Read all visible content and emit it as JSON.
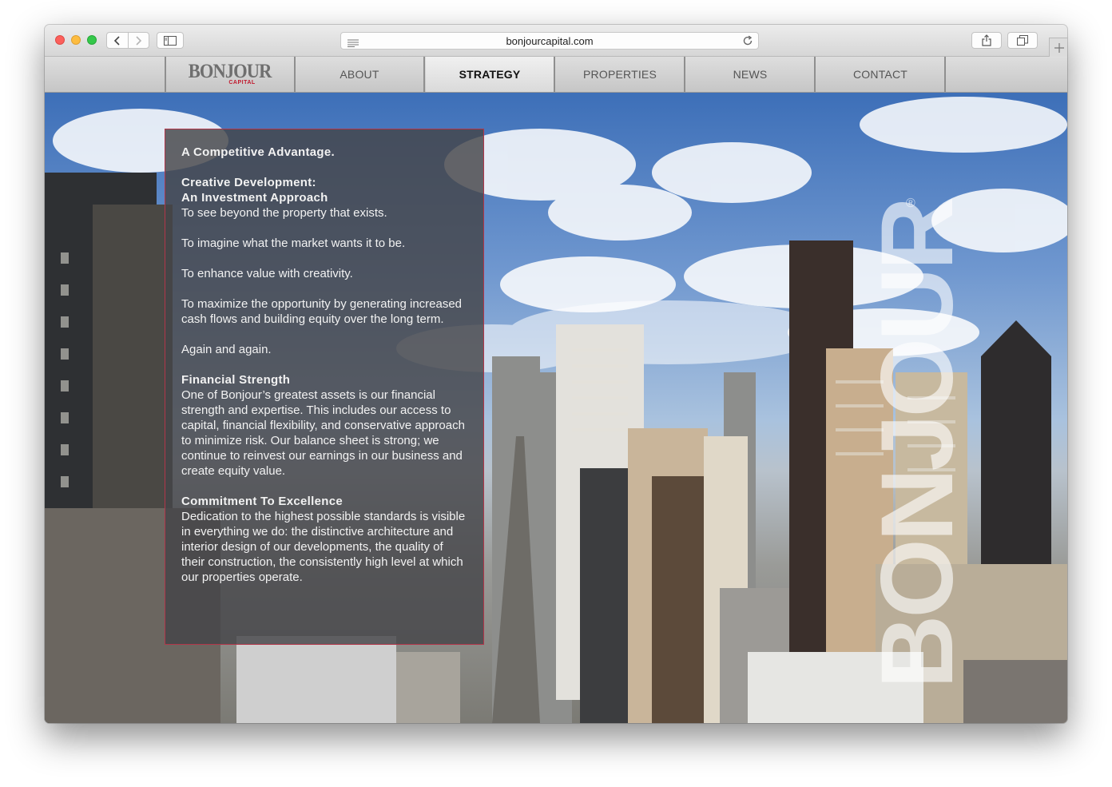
{
  "browser": {
    "url": "bonjourcapital.com"
  },
  "site": {
    "logo": {
      "word": "BONJOUR",
      "sub": "CAPITAL"
    },
    "nav": [
      {
        "label": "ABOUT",
        "active": false
      },
      {
        "label": "STRATEGY",
        "active": true
      },
      {
        "label": "PROPERTIES",
        "active": false
      },
      {
        "label": "NEWS",
        "active": false
      },
      {
        "label": "CONTACT",
        "active": false
      }
    ]
  },
  "panel": {
    "title": "A Competitive Advantage.",
    "section1": {
      "heading1": "Creative Development:",
      "heading2": "An Investment Approach",
      "lines": [
        "To see beyond the property that exists.",
        "To imagine what the market wants it to be.",
        "To enhance value with creativity.",
        "To maximize the opportunity by generating increased cash flows and building equity over the long term.",
        "Again and again."
      ]
    },
    "section2": {
      "heading": "Financial Strength",
      "body": "One of Bonjour’s greatest assets is our financial strength and expertise. This includes our access to capital, financial flexibility, and conservative approach to minimize risk. Our balance sheet is strong; we continue to reinvest our earnings in our business and create equity value."
    },
    "section3": {
      "heading": "Commitment To Excellence",
      "body": "Dedication to the highest possible standards is visible in everything we do: the distinctive architecture and interior design of our developments, the quality of their construction, the consistently high level at which our properties operate."
    }
  },
  "watermark": {
    "text": "BONJOUR",
    "mark": "®"
  },
  "colors": {
    "accent": "#c0182c",
    "panel_border": "#b2364a"
  }
}
